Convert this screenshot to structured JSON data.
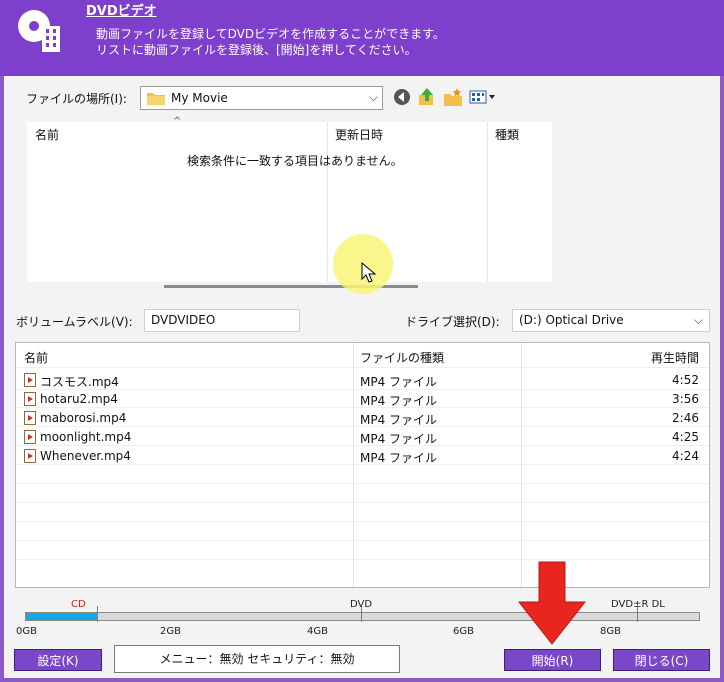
{
  "header": {
    "title": "DVDビデオ",
    "desc_line1": "動画ファイルを登録してDVDビデオを作成することができます。",
    "desc_line2": "リストに動画ファイルを登録後、[開始]を押してください。"
  },
  "location": {
    "label": "ファイルの場所(I):",
    "value": "My Movie"
  },
  "browser": {
    "columns": [
      "名前",
      "更新日時",
      "種類"
    ],
    "empty_message": "検索条件に一致する項目はありません。"
  },
  "volume": {
    "label": "ボリュームラベル(V):",
    "value": "DVDVIDEO"
  },
  "drive": {
    "label": "ドライブ選択(D):",
    "value": "(D:)  Optical Drive"
  },
  "list": {
    "columns": [
      "名前",
      "ファイルの種類",
      "再生時間"
    ],
    "rows": [
      {
        "name": "コスモス.mp4",
        "type": "MP4 ファイル",
        "duration": "4:52"
      },
      {
        "name": "hotaru2.mp4",
        "type": "MP4 ファイル",
        "duration": "3:56"
      },
      {
        "name": "maborosi.mp4",
        "type": "MP4 ファイル",
        "duration": "2:46"
      },
      {
        "name": "moonlight.mp4",
        "type": "MP4 ファイル",
        "duration": "4:25"
      },
      {
        "name": "Whenever.mp4",
        "type": "MP4 ファイル",
        "duration": "4:24"
      }
    ]
  },
  "capacity": {
    "markers": [
      "CD",
      "DVD",
      "DVD±R DL"
    ],
    "ticks": [
      "0GB",
      "2GB",
      "4GB",
      "6GB",
      "8GB"
    ]
  },
  "buttons": {
    "settings": "設定(K)",
    "start": "開始(R)",
    "close": "閉じる(C)"
  },
  "status_text": "メニュー：無効  セキュリティ：無効",
  "colors": {
    "header": "#7d3fcc",
    "button": "#7a47c8",
    "capacity_fill": "#16a8e6",
    "arrow": "#e8251f",
    "cursor_highlight": "#f8f578"
  }
}
